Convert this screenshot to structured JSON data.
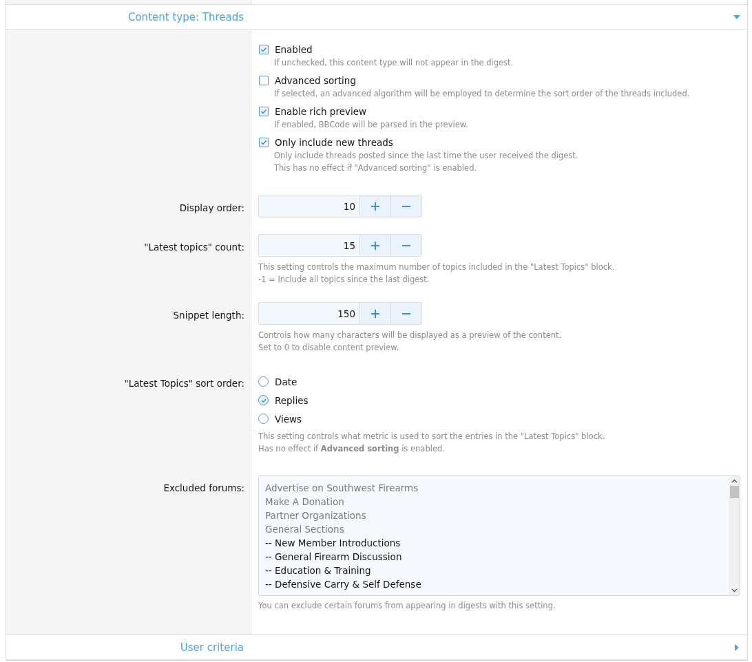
{
  "top_section": {
    "title": "Content type: Threads",
    "expanded": true
  },
  "checkboxes": [
    {
      "label": "Enabled",
      "hint": "If unchecked, this content type will not appear in the digest.",
      "checked": true
    },
    {
      "label": "Advanced sorting",
      "hint": "If selected, an advanced algorithm will be employed to determine the sort order of the threads included.",
      "checked": false
    },
    {
      "label": "Enable rich preview",
      "hint": "If enabled, BBCode will be parsed in the preview.",
      "checked": true
    },
    {
      "label": "Only include new threads",
      "hint": "Only include threads posted since the last time the user received the digest.\nThis has no effect if \"Advanced sorting\" is enabled.",
      "checked": true
    }
  ],
  "number_fields": [
    {
      "label": "Display order:",
      "value": "10"
    },
    {
      "label": "\"Latest topics\" count:",
      "value": "15",
      "hint": "This setting controls the maximum number of topics included in the \"Latest Topics\" block.\n-1 = Include all topics since the last digest."
    },
    {
      "label": "Snippet length:",
      "value": "150",
      "hint": "Controls how many characters will be displayed as a preview of the content.\nSet to 0 to disable content preview."
    }
  ],
  "sort_order": {
    "label": "\"Latest Topics\" sort order:",
    "options": [
      {
        "label": "Date",
        "selected": false
      },
      {
        "label": "Replies",
        "selected": true
      },
      {
        "label": "Views",
        "selected": false
      }
    ],
    "hint": "This setting controls what metric is used to sort the entries in the \"Latest Topics\" block.\nHas no effect if **Advanced sorting** is enabled."
  },
  "excluded_forums": {
    "label": "Excluded forums:",
    "items": [
      {
        "label": "Advertise on Southwest Firearms",
        "disabled": true
      },
      {
        "label": "Make A Donation",
        "disabled": true
      },
      {
        "label": "Partner Organizations",
        "disabled": true
      },
      {
        "label": "General Sections",
        "disabled": true
      },
      {
        "label": "-- New Member Introductions",
        "disabled": false
      },
      {
        "label": "-- General Firearm Discussion",
        "disabled": false
      },
      {
        "label": "-- Education & Training",
        "disabled": false
      },
      {
        "label": "-- Defensive Carry & Self Defense",
        "disabled": false
      }
    ],
    "hint": "You can exclude certain forums from appearing in digests with this setting."
  },
  "next_section": {
    "title": "User criteria",
    "expanded": false
  }
}
